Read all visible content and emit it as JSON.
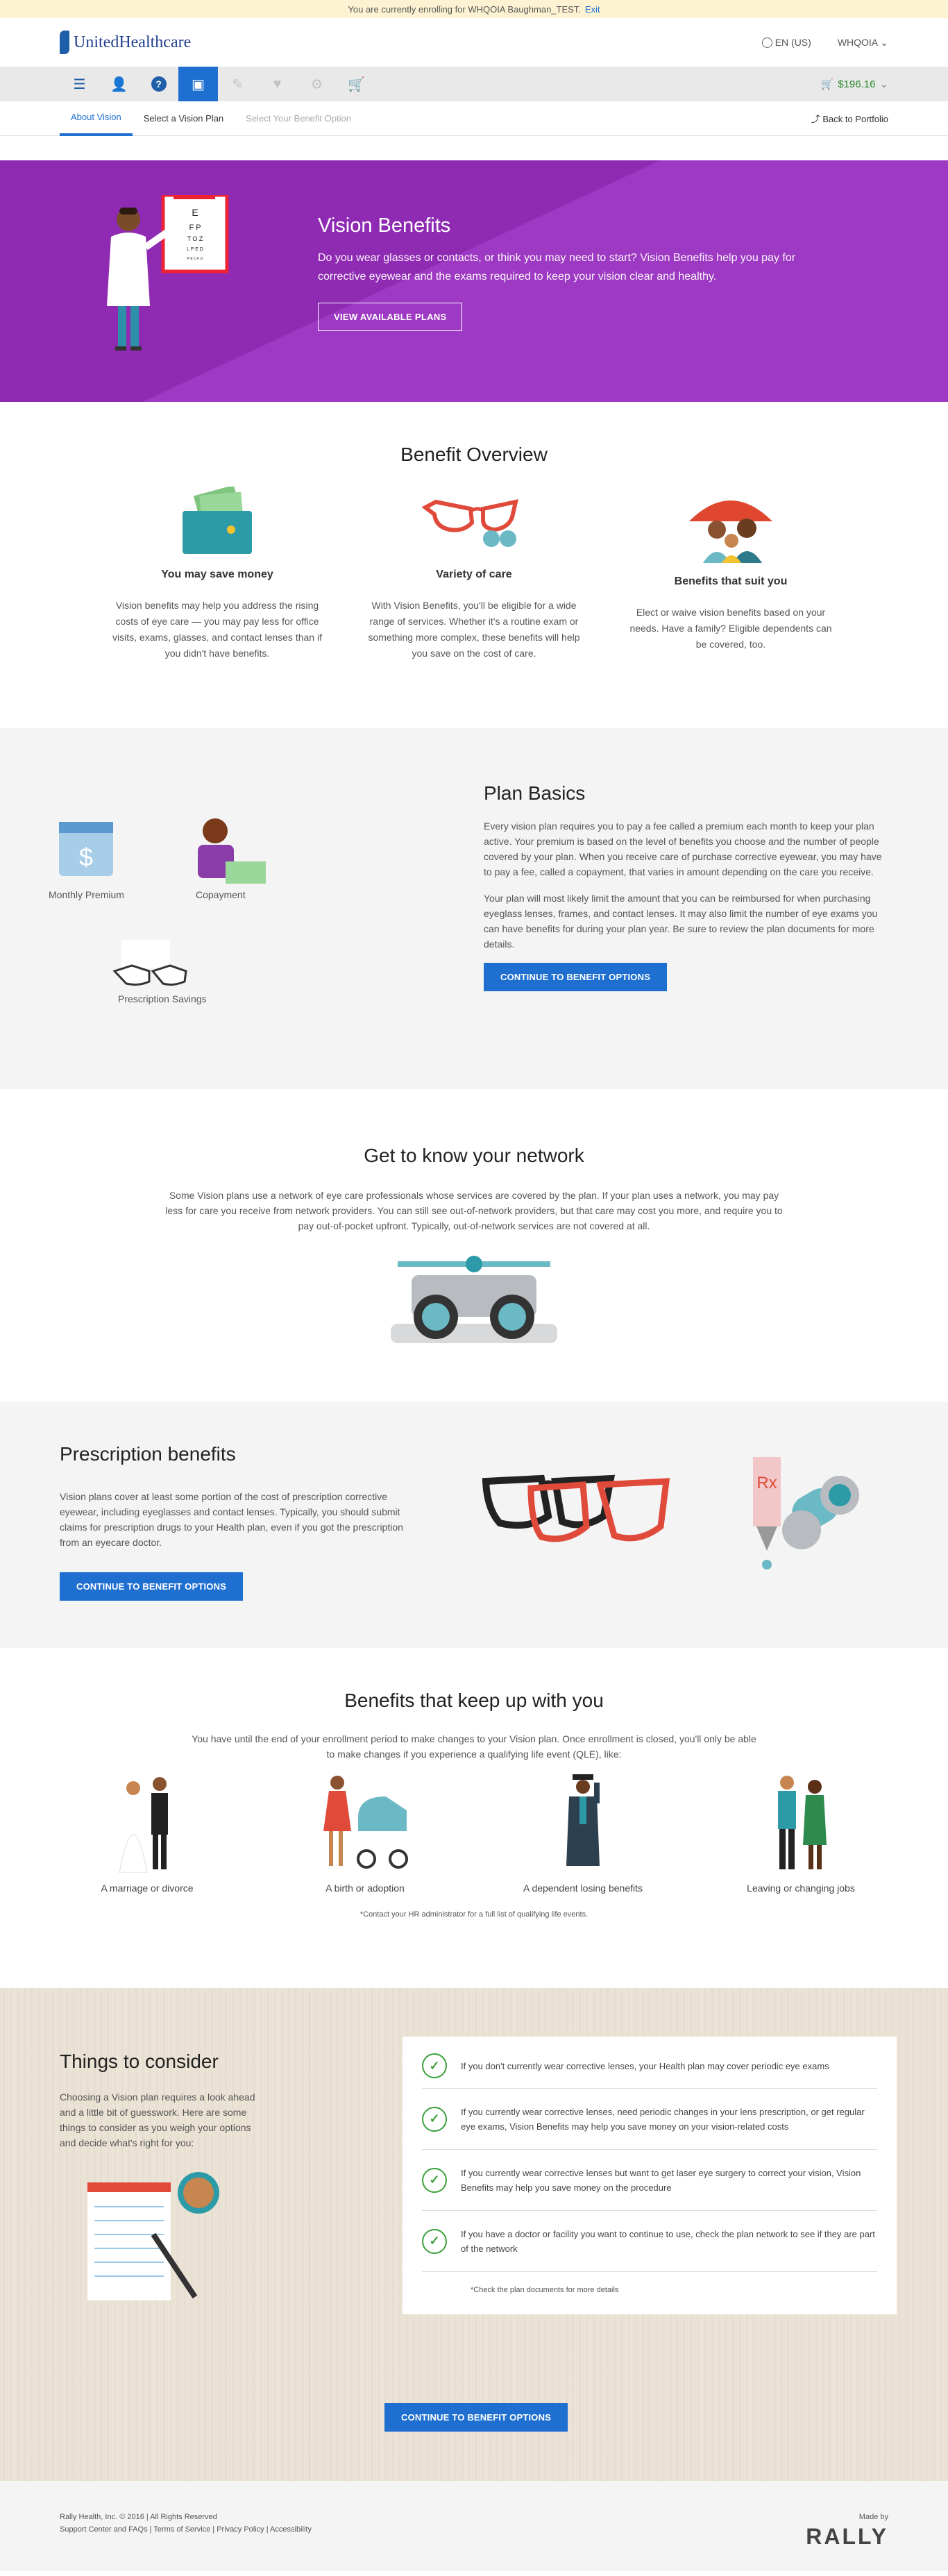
{
  "topbar": {
    "text": "You are currently enrolling for WHQOIA Baughman_TEST.",
    "link": "Exit"
  },
  "header": {
    "logo": "UnitedHealthcare",
    "language": "EN (US)",
    "account": "WHQOIA"
  },
  "nav": {
    "icons": [
      "menu-icon",
      "person-icon",
      "help-icon",
      "vision-icon",
      "pencil-icon",
      "heart-icon",
      "gear-icon",
      "cart-icon"
    ],
    "cart_total": "$196.16"
  },
  "subnav": {
    "tabs": [
      "About Vision",
      "Select a Vision Plan",
      "Select Your Benefit Option"
    ],
    "back": "Back to Portfolio"
  },
  "hero": {
    "title": "Vision Benefits",
    "desc": "Do you wear glasses or contacts, or think you may need to start? Vision Benefits help you pay for corrective eyewear and the exams required to keep your vision clear and healthy.",
    "button": "VIEW AVAILABLE PLANS",
    "chart_letters": [
      "E",
      "F P",
      "T O Z",
      "L P E D",
      "P E C F D"
    ]
  },
  "overview": {
    "title": "Benefit Overview",
    "cols": [
      {
        "title": "You may save money",
        "text": "Vision benefits may help you address the rising costs of eye care — you may pay less for office visits, exams, glasses, and contact lenses than if you didn't have benefits."
      },
      {
        "title": "Variety of care",
        "text": "With Vision Benefits, you'll be eligible for a wide range of services. Whether it's a routine exam or something more complex, these benefits will help you save on the cost of care."
      },
      {
        "title": "Benefits that suit you",
        "text": "Elect or waive vision benefits based on your needs. Have a family? Eligible dependents can be covered, too."
      }
    ]
  },
  "basics": {
    "title": "Plan Basics",
    "labels": [
      "Monthly Premium",
      "Copayment",
      "Prescription Savings"
    ],
    "p1": "Every vision plan requires you to pay a fee called a premium each month to keep your plan active. Your premium is based on the level of benefits you choose and the number of people covered by your plan. When you receive care of purchase corrective eyewear, you may have to pay a fee, called a copayment, that varies in amount depending on the care you receive.",
    "p2": "Your plan will most likely limit the amount that you can be reimbursed for when purchasing eyeglass lenses, frames, and contact lenses. It may also limit the number of eye exams you can have benefits for during your plan year. Be sure to review the plan documents for more details.",
    "button": "CONTINUE TO BENEFIT OPTIONS"
  },
  "network": {
    "title": "Get to know your network",
    "text": "Some Vision plans use a network of eye care professionals whose services are covered by the plan. If your plan uses a network, you may pay less for care you receive from network providers. You can still see out-of-network providers, but that care may cost you more, and require you to pay out-of-pocket upfront. Typically, out-of-network services are not covered at all."
  },
  "rx": {
    "title": "Prescription benefits",
    "text": "Vision plans cover at least some portion of the cost of prescription corrective eyewear, including eyeglasses and contact lenses. Typically, you should submit claims for prescription drugs to your Health plan, even if you got the prescription from an eyecare doctor.",
    "button": "CONTINUE TO BENEFIT OPTIONS"
  },
  "keepup": {
    "title": "Benefits that keep up with you",
    "text": "You have until the end of your enrollment period to make changes to your Vision plan. Once enrollment is closed, you'll only be able to make changes if you experience a qualifying life event (QLE), like:",
    "items": [
      "A marriage or divorce",
      "A birth or adoption",
      "A dependent losing benefits",
      "Leaving or changing jobs"
    ],
    "note": "*Contact your HR administrator for a full list of qualifying life events."
  },
  "consider": {
    "title": "Things to consider",
    "text": "Choosing a Vision plan requires a look ahead and a little bit of guesswork. Here are some things to consider as you weigh your options and decide what's right for you:",
    "items": [
      "If you don't currently wear corrective lenses, your Health plan may cover periodic eye exams",
      "If you currently wear corrective lenses, need periodic changes in your lens prescription, or get regular eye exams, Vision Benefits may help you save money on your vision-related costs",
      "If you currently wear corrective lenses but want to get laser eye surgery to correct your vision, Vision Benefits may help you save money on the procedure",
      "If you have a doctor or facility you want to continue to use, check the plan network to see if they are part of the network"
    ],
    "note": "*Check the plan documents for more details",
    "button": "CONTINUE TO BENEFIT OPTIONS"
  },
  "footer": {
    "copyright": "Rally Health, Inc. © 2016  |  All Rights Reserved",
    "links": "Support Center and FAQs  |  Terms of Service  |  Privacy Policy  |  Accessibility",
    "made_by": "Made by",
    "brand": "RALLY"
  }
}
